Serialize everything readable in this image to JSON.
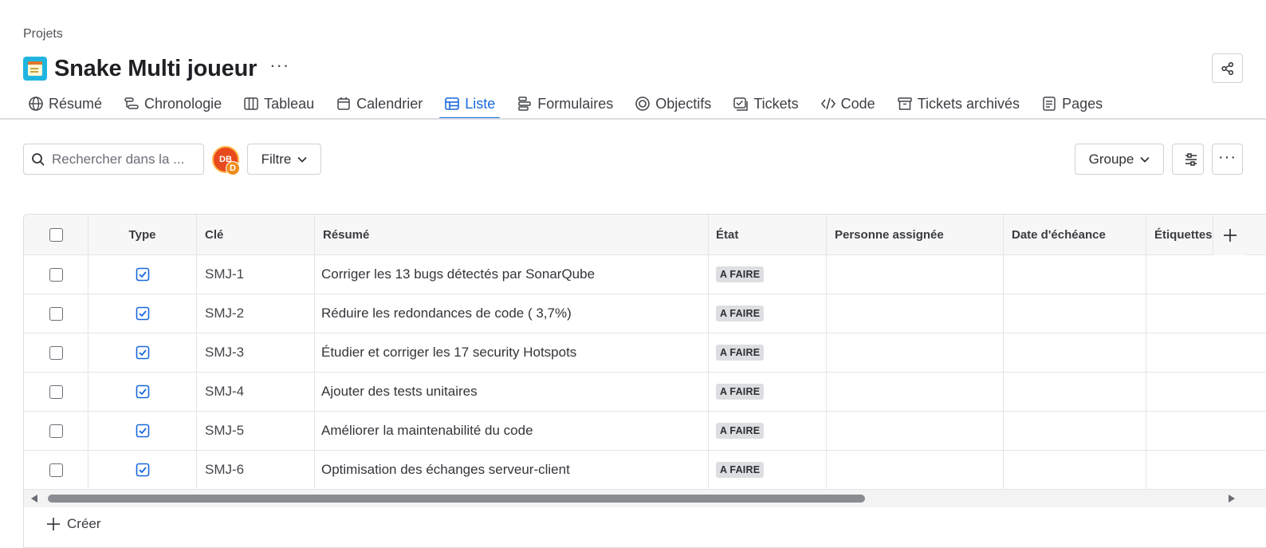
{
  "breadcrumb": "Projets",
  "project": {
    "title": "Snake Multi joueur",
    "more_label": "···"
  },
  "tabs": [
    {
      "label": "Résumé",
      "icon": "globe-icon"
    },
    {
      "label": "Chronologie",
      "icon": "timeline-icon"
    },
    {
      "label": "Tableau",
      "icon": "board-icon"
    },
    {
      "label": "Calendrier",
      "icon": "calendar-icon"
    },
    {
      "label": "Liste",
      "icon": "list-icon",
      "active": true
    },
    {
      "label": "Formulaires",
      "icon": "forms-icon"
    },
    {
      "label": "Objectifs",
      "icon": "target-icon"
    },
    {
      "label": "Tickets",
      "icon": "tickets-icon"
    },
    {
      "label": "Code",
      "icon": "code-icon"
    },
    {
      "label": "Tickets archivés",
      "icon": "archive-icon"
    },
    {
      "label": "Pages",
      "icon": "pages-icon"
    }
  ],
  "toolbar": {
    "search_placeholder": "Rechercher dans la ...",
    "avatar_initials": "DB",
    "avatar_sub_initial": "D",
    "filter_label": "Filtre",
    "group_label": "Groupe",
    "more_label": "···"
  },
  "table": {
    "columns": {
      "type": "Type",
      "key": "Clé",
      "summary": "Résumé",
      "state": "État",
      "assignee": "Personne assignée",
      "due": "Date d'échéance",
      "labels": "Étiquettes"
    },
    "rows": [
      {
        "key": "SMJ-1",
        "summary": "Corriger les 13 bugs détectés par SonarQube",
        "state": "A FAIRE"
      },
      {
        "key": "SMJ-2",
        "summary": "Réduire les redondances de code ( 3,7%)",
        "state": "A FAIRE"
      },
      {
        "key": "SMJ-3",
        "summary": "Étudier et corriger les 17 security Hotspots",
        "state": "A FAIRE"
      },
      {
        "key": "SMJ-4",
        "summary": "Ajouter des tests unitaires",
        "state": "A FAIRE"
      },
      {
        "key": "SMJ-5",
        "summary": "Améliorer la maintenabilité du code",
        "state": "A FAIRE"
      },
      {
        "key": "SMJ-6",
        "summary": "Optimisation des échanges serveur-client",
        "state": "A FAIRE"
      }
    ],
    "create_label": "Créer"
  },
  "colors": {
    "accent": "#1868db",
    "type_task": "#1868db",
    "status_bg": "#dddee1"
  }
}
